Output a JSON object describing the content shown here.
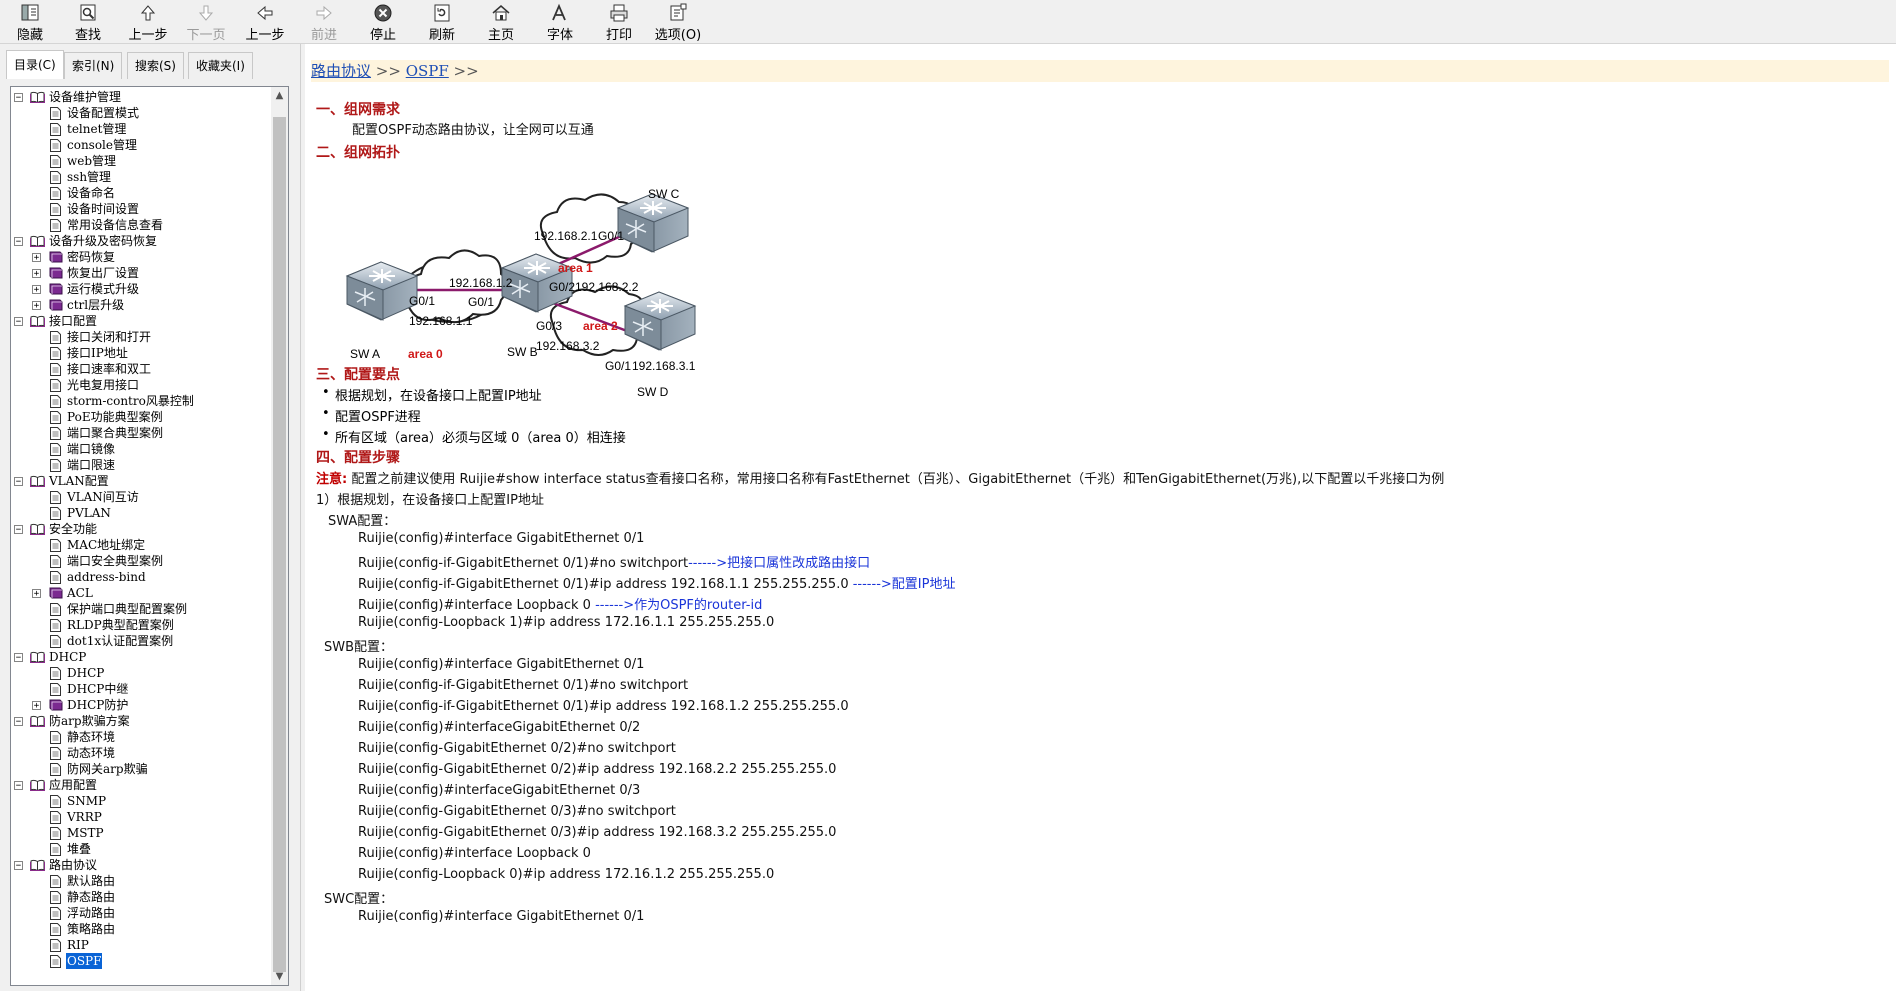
{
  "toolbar": {
    "buttons": [
      {
        "label": "隐藏",
        "icon": "hide-icon"
      },
      {
        "label": "查找",
        "icon": "find-icon"
      },
      {
        "label": "上一步",
        "icon": "up-arrow-icon"
      },
      {
        "label": "下一页",
        "icon": "down-arrow-icon"
      },
      {
        "label": "上一步",
        "icon": "back-arrow-icon"
      },
      {
        "label": "前进",
        "icon": "forward-arrow-icon"
      },
      {
        "label": "停止",
        "icon": "stop-icon"
      },
      {
        "label": "刷新",
        "icon": "refresh-icon"
      },
      {
        "label": "主页",
        "icon": "home-icon"
      },
      {
        "label": "字体",
        "icon": "font-icon"
      },
      {
        "label": "打印",
        "icon": "print-icon"
      },
      {
        "label": "选项(O)",
        "icon": "options-icon"
      }
    ]
  },
  "nav": {
    "tabs": [
      "目录(C)",
      "索引(N)",
      "搜索(S)",
      "收藏夹(I)"
    ],
    "tree": [
      {
        "label": "设备维护管理",
        "type": "book-open",
        "level": 0,
        "expander": "−"
      },
      {
        "label": "设备配置模式",
        "type": "page",
        "level": 1
      },
      {
        "label": "telnet管理",
        "type": "page",
        "level": 1
      },
      {
        "label": "console管理",
        "type": "page",
        "level": 1
      },
      {
        "label": "web管理",
        "type": "page",
        "level": 1
      },
      {
        "label": "ssh管理",
        "type": "page",
        "level": 1
      },
      {
        "label": "设备命名",
        "type": "page",
        "level": 1
      },
      {
        "label": "设备时间设置",
        "type": "page",
        "level": 1
      },
      {
        "label": "常用设备信息查看",
        "type": "page",
        "level": 1
      },
      {
        "label": "设备升级及密码恢复",
        "type": "book-open",
        "level": 0,
        "expander": "−"
      },
      {
        "label": "密码恢复",
        "type": "book-closed",
        "level": 1,
        "expander": "+"
      },
      {
        "label": "恢复出厂设置",
        "type": "book-closed",
        "level": 1,
        "expander": "+"
      },
      {
        "label": "运行模式升级",
        "type": "book-closed",
        "level": 1,
        "expander": "+"
      },
      {
        "label": "ctrl层升级",
        "type": "book-closed",
        "level": 1,
        "expander": "+"
      },
      {
        "label": "接口配置",
        "type": "book-open",
        "level": 0,
        "expander": "−"
      },
      {
        "label": "接口关闭和打开",
        "type": "page",
        "level": 1
      },
      {
        "label": "接口IP地址",
        "type": "page",
        "level": 1
      },
      {
        "label": "接口速率和双工",
        "type": "page",
        "level": 1
      },
      {
        "label": "光电复用接口",
        "type": "page",
        "level": 1
      },
      {
        "label": "storm-contro风暴控制",
        "type": "page",
        "level": 1
      },
      {
        "label": "PoE功能典型案例",
        "type": "page",
        "level": 1
      },
      {
        "label": "端口聚合典型案例",
        "type": "page",
        "level": 1
      },
      {
        "label": "端口镜像",
        "type": "page",
        "level": 1
      },
      {
        "label": "端口限速",
        "type": "page",
        "level": 1
      },
      {
        "label": "VLAN配置",
        "type": "book-open",
        "level": 0,
        "expander": "−"
      },
      {
        "label": "VLAN间互访",
        "type": "page",
        "level": 1
      },
      {
        "label": "PVLAN",
        "type": "page",
        "level": 1
      },
      {
        "label": "安全功能",
        "type": "book-open",
        "level": 0,
        "expander": "−"
      },
      {
        "label": "MAC地址绑定",
        "type": "page",
        "level": 1
      },
      {
        "label": "端口安全典型案例",
        "type": "page",
        "level": 1
      },
      {
        "label": "address-bind",
        "type": "page",
        "level": 1
      },
      {
        "label": "ACL",
        "type": "book-closed",
        "level": 1,
        "expander": "+"
      },
      {
        "label": "保护端口典型配置案例",
        "type": "page",
        "level": 1
      },
      {
        "label": "RLDP典型配置案例",
        "type": "page",
        "level": 1
      },
      {
        "label": "dot1x认证配置案例",
        "type": "page",
        "level": 1
      },
      {
        "label": "DHCP",
        "type": "book-open",
        "level": 0,
        "expander": "−"
      },
      {
        "label": "DHCP",
        "type": "page",
        "level": 1
      },
      {
        "label": "DHCP中继",
        "type": "page",
        "level": 1
      },
      {
        "label": "DHCP防护",
        "type": "book-closed",
        "level": 1,
        "expander": "+"
      },
      {
        "label": "防arp欺骗方案",
        "type": "book-open",
        "level": 0,
        "expander": "−"
      },
      {
        "label": "静态环境",
        "type": "page",
        "level": 1
      },
      {
        "label": "动态环境",
        "type": "page",
        "level": 1
      },
      {
        "label": "防网关arp欺骗",
        "type": "page",
        "level": 1
      },
      {
        "label": "应用配置",
        "type": "book-open",
        "level": 0,
        "expander": "−"
      },
      {
        "label": "SNMP",
        "type": "page",
        "level": 1
      },
      {
        "label": "VRRP",
        "type": "page",
        "level": 1
      },
      {
        "label": "MSTP",
        "type": "page",
        "level": 1
      },
      {
        "label": "堆叠",
        "type": "page",
        "level": 1
      },
      {
        "label": "路由协议",
        "type": "book-open",
        "level": 0,
        "expander": "−"
      },
      {
        "label": "默认路由",
        "type": "page",
        "level": 1
      },
      {
        "label": "静态路由",
        "type": "page",
        "level": 1
      },
      {
        "label": "浮动路由",
        "type": "page",
        "level": 1
      },
      {
        "label": "策略路由",
        "type": "page",
        "level": 1
      },
      {
        "label": "RIP",
        "type": "page",
        "level": 1
      },
      {
        "label": "OSPF",
        "type": "page",
        "level": 1,
        "selected": true
      }
    ]
  },
  "content": {
    "breadcrumb": {
      "item1": "路由协议",
      "sep1": " >> ",
      "item2": "OSPF",
      "sep2": " >>"
    },
    "sec1": {
      "title": "一、组网需求",
      "text": "配置OSPF动态路由协议，让全网可以互通"
    },
    "sec2": {
      "title": "二、组网拓扑"
    },
    "topology": {
      "labels": {
        "swa": "SW A",
        "swb": "SW B",
        "swc": "SW C",
        "swd": "SW D",
        "area0": "area  0",
        "area1": "area 1",
        "area2": "area 2",
        "a_port": "G0/1",
        "a_ip": "192.168.1.1",
        "b_ip1": "192.168.1.2",
        "b_port1": "G0/1",
        "b_port2": "G0/2",
        "b_ip2": "192.168.2.2",
        "b_port3": "G0/3",
        "b_ip3": "192.168.3.2",
        "c_ip": "192.168.2.1",
        "c_port": "G0/1",
        "d_port": "G0/1",
        "d_ip": "192.168.3.1"
      }
    },
    "sec3": {
      "title": "三、配置要点",
      "bullets": [
        "根据规划，在设备接口上配置IP地址",
        "配置OSPF进程",
        "所有区域（area）必须与区域 0（area 0）相连接"
      ]
    },
    "sec4": {
      "title": "四、配置步骤",
      "note_label": "注意:",
      "note_text": " 配置之前建议使用 Ruijie#show interface status查看接口名称，常用接口名称有FastEthernet（百兆）、GigabitEthernet（千兆）和TenGigabitEthernet(万兆),以下配置以千兆接口为例",
      "step1": "1）根据规划，在设备接口上配置IP地址",
      "swa_label": "SWA配置：",
      "swa": [
        {
          "cmd": "Ruijie(config)#interface GigabitEthernet 0/1",
          "comment": ""
        },
        {
          "cmd": "Ruijie(config-if-GigabitEthernet 0/1)#no switchport",
          "comment": "------>把接口属性改成路由接口"
        },
        {
          "cmd": "Ruijie(config-if-GigabitEthernet 0/1)#ip address 192.168.1.1 255.255.255.0   ",
          "comment": "------>配置IP地址"
        },
        {
          "cmd": "Ruijie(config)#interface Loopback 0    ",
          "comment": "------>作为OSPF的router-id"
        },
        {
          "cmd": "Ruijie(config-Loopback 1)#ip address 172.16.1.1 255.255.255.0",
          "comment": ""
        }
      ],
      "swb_label": "SWB配置：",
      "swb": [
        "Ruijie(config)#interface GigabitEthernet 0/1",
        "Ruijie(config-if-GigabitEthernet 0/1)#no switchport",
        "Ruijie(config-if-GigabitEthernet 0/1)#ip address 192.168.1.2 255.255.255.0",
        "Ruijie(config)#interfaceGigabitEthernet 0/2",
        "Ruijie(config-GigabitEthernet 0/2)#no switchport",
        "Ruijie(config-GigabitEthernet 0/2)#ip address 192.168.2.2 255.255.255.0",
        "Ruijie(config)#interfaceGigabitEthernet 0/3",
        "Ruijie(config-GigabitEthernet 0/3)#no switchport",
        "Ruijie(config-GigabitEthernet 0/3)#ip address 192.168.3.2 255.255.255.0",
        "Ruijie(config)#interface Loopback 0",
        "Ruijie(config-Loopback 0)#ip address 172.16.1.2 255.255.255.0"
      ],
      "swc_label": "SWC配置：",
      "swc": [
        "Ruijie(config)#interface GigabitEthernet 0/1"
      ]
    }
  },
  "colors": {
    "heading": "#b01818",
    "comment": "#1a34d8",
    "crumb_bg": "#fef4dd",
    "selected": "#0a64d6",
    "link_line": "#8b1a6b",
    "area_label": "#d01818"
  }
}
